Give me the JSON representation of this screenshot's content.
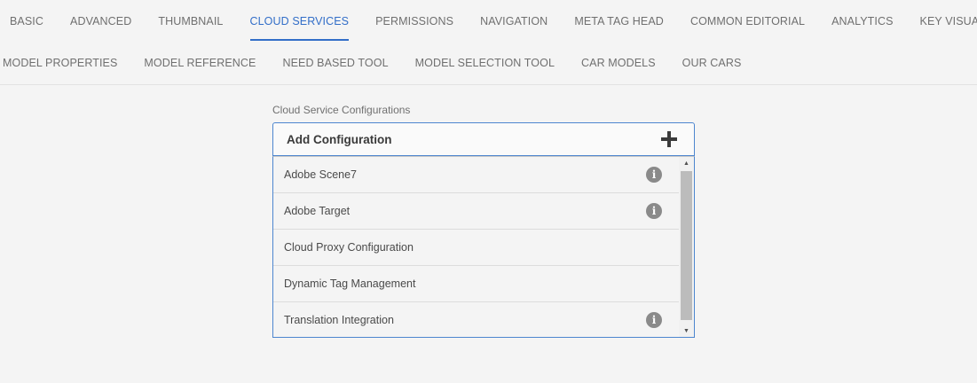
{
  "tabs_row1": [
    {
      "label": "BASIC",
      "active": false
    },
    {
      "label": "ADVANCED",
      "active": false
    },
    {
      "label": "THUMBNAIL",
      "active": false
    },
    {
      "label": "CLOUD SERVICES",
      "active": true
    },
    {
      "label": "PERMISSIONS",
      "active": false
    },
    {
      "label": "NAVIGATION",
      "active": false
    },
    {
      "label": "META TAG HEAD",
      "active": false
    },
    {
      "label": "COMMON EDITORIAL",
      "active": false
    },
    {
      "label": "ANALYTICS",
      "active": false
    },
    {
      "label": "KEY VISUAL",
      "active": false
    }
  ],
  "tabs_row2": [
    {
      "label": "MODEL PROPERTIES"
    },
    {
      "label": "MODEL REFERENCE"
    },
    {
      "label": "NEED BASED TOOL"
    },
    {
      "label": "MODEL SELECTION TOOL"
    },
    {
      "label": "CAR MODELS"
    },
    {
      "label": "OUR CARS"
    }
  ],
  "cloud_config": {
    "label": "Cloud Service Configurations",
    "add_label": "Add Configuration",
    "add_icon": "plus-icon",
    "items": [
      {
        "label": "Adobe Scene7",
        "info": true
      },
      {
        "label": "Adobe Target",
        "info": true
      },
      {
        "label": "Cloud Proxy Configuration",
        "info": false
      },
      {
        "label": "Dynamic Tag Management",
        "info": false
      },
      {
        "label": "Translation Integration",
        "info": true
      }
    ]
  },
  "colors": {
    "accent": "#326ec8",
    "border": "#4d86cf",
    "background": "#f4f4f4"
  }
}
